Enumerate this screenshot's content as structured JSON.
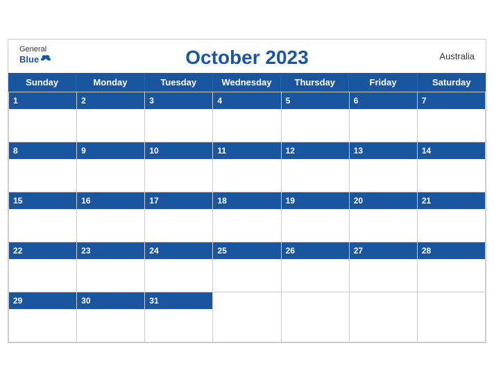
{
  "header": {
    "title": "October 2023",
    "country": "Australia",
    "logo": {
      "general": "General",
      "blue": "Blue"
    }
  },
  "days_of_week": [
    "Sunday",
    "Monday",
    "Tuesday",
    "Wednesday",
    "Thursday",
    "Friday",
    "Saturday"
  ],
  "weeks": [
    [
      {
        "date": "1",
        "empty": false
      },
      {
        "date": "2",
        "empty": false
      },
      {
        "date": "3",
        "empty": false
      },
      {
        "date": "4",
        "empty": false
      },
      {
        "date": "5",
        "empty": false
      },
      {
        "date": "6",
        "empty": false
      },
      {
        "date": "7",
        "empty": false
      }
    ],
    [
      {
        "date": "8",
        "empty": false
      },
      {
        "date": "9",
        "empty": false
      },
      {
        "date": "10",
        "empty": false
      },
      {
        "date": "11",
        "empty": false
      },
      {
        "date": "12",
        "empty": false
      },
      {
        "date": "13",
        "empty": false
      },
      {
        "date": "14",
        "empty": false
      }
    ],
    [
      {
        "date": "15",
        "empty": false
      },
      {
        "date": "16",
        "empty": false
      },
      {
        "date": "17",
        "empty": false
      },
      {
        "date": "18",
        "empty": false
      },
      {
        "date": "19",
        "empty": false
      },
      {
        "date": "20",
        "empty": false
      },
      {
        "date": "21",
        "empty": false
      }
    ],
    [
      {
        "date": "22",
        "empty": false
      },
      {
        "date": "23",
        "empty": false
      },
      {
        "date": "24",
        "empty": false
      },
      {
        "date": "25",
        "empty": false
      },
      {
        "date": "26",
        "empty": false
      },
      {
        "date": "27",
        "empty": false
      },
      {
        "date": "28",
        "empty": false
      }
    ],
    [
      {
        "date": "29",
        "empty": false
      },
      {
        "date": "30",
        "empty": false
      },
      {
        "date": "31",
        "empty": false
      },
      {
        "date": "",
        "empty": true
      },
      {
        "date": "",
        "empty": true
      },
      {
        "date": "",
        "empty": true
      },
      {
        "date": "",
        "empty": true
      }
    ]
  ],
  "accent_color": "#1a56a0"
}
